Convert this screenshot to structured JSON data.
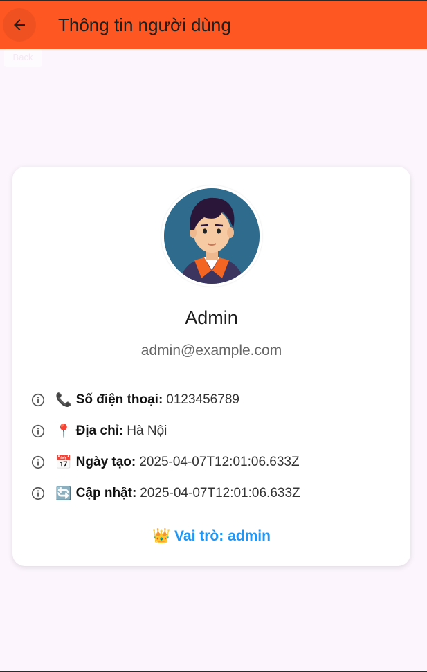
{
  "appbar": {
    "title": "Thông tin người dùng",
    "back_tooltip": "Back",
    "color": "#ff5722"
  },
  "profile": {
    "avatar_alt": "user-avatar",
    "name": "Admin",
    "email": "admin@example.com",
    "details": [
      {
        "emoji": "📞",
        "label": "Số điện thoại:",
        "value": "0123456789"
      },
      {
        "emoji": "📍",
        "label": "Địa chỉ:",
        "value": "Hà Nội"
      },
      {
        "emoji": "📅",
        "label": "Ngày tạo:",
        "value": "2025-04-07T12:01:06.633Z"
      },
      {
        "emoji": "🔄",
        "label": "Cập nhật:",
        "value": "2025-04-07T12:01:06.633Z"
      }
    ],
    "role": "👑 Vai trò: admin",
    "role_color": "#2196f3"
  }
}
